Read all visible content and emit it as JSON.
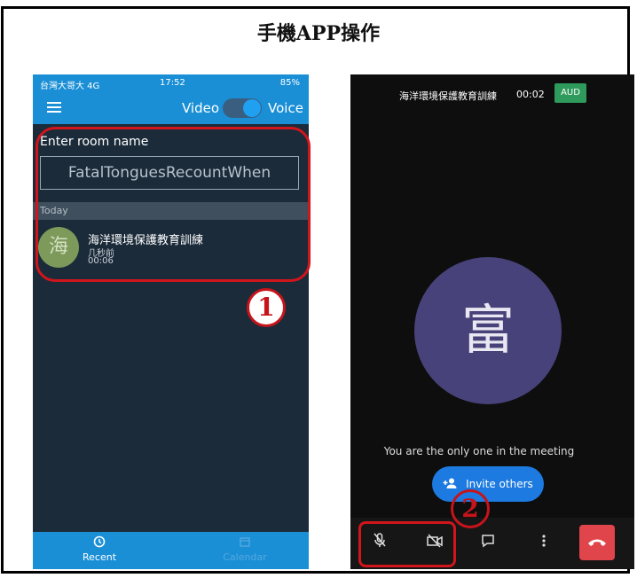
{
  "title": "手機APP操作",
  "left_phone": {
    "status_bar": {
      "carrier": "台灣大哥大 4G",
      "time": "17:52",
      "battery": "85%"
    },
    "app_bar": {
      "video_label": "Video",
      "voice_label": "Voice",
      "menu_icon": "hamburger-icon"
    },
    "room_label": "Enter room name",
    "room_input_value": "FatalTonguesRecountWhen",
    "section_header": "Today",
    "meeting": {
      "avatar_char": "海",
      "title": "海洋環境保護教育訓練",
      "ago": "几秒前",
      "duration": "00:06"
    },
    "bottom_nav": [
      {
        "label": "Recent",
        "icon": "history-icon"
      },
      {
        "label": "Calendar",
        "icon": "calendar-icon"
      }
    ]
  },
  "right_phone": {
    "meeting_title": "海洋環境保護教育訓練",
    "elapsed": "00:02",
    "badge": "AUD",
    "avatar_char": "富",
    "only_message": "You are the only one in the meeting",
    "invite_label": "Invite others"
  },
  "annotations": {
    "marker1": "1",
    "marker2": "2"
  },
  "colors": {
    "accent": "#1a8fd6",
    "highlight": "#d0151b",
    "end_call": "#e0454b",
    "avatar_right": "#47437a",
    "avatar_left": "#7d9a5a"
  }
}
